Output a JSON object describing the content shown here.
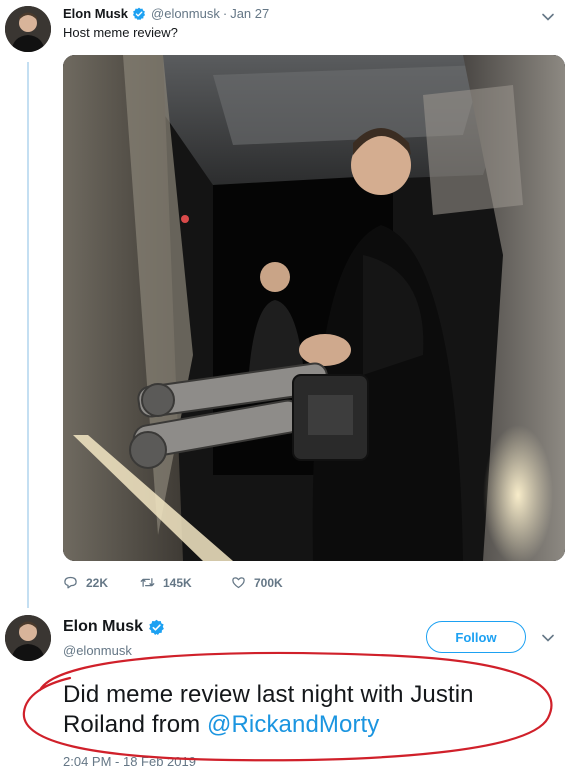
{
  "tweet1": {
    "author_name": "Elon Musk",
    "handle": "@elonmusk",
    "separator": "·",
    "date": "Jan 27",
    "text": "Host meme review?",
    "actions": {
      "replies": "22K",
      "retweets": "145K",
      "likes": "700K"
    }
  },
  "tweet2": {
    "author_name": "Elon Musk",
    "handle": "@elonmusk",
    "follow_label": "Follow",
    "text_before_mention": "Did meme review last night with Justin Roiland from ",
    "mention": "@RickandMorty",
    "timestamp": "2:04 PM - 18 Feb 2019"
  },
  "icons": {
    "verified": "verified-badge-icon",
    "chevron": "chevron-down-icon",
    "reply": "reply-icon",
    "retweet": "retweet-icon",
    "like": "heart-icon"
  },
  "colors": {
    "accent": "#1da1f2",
    "mention": "#1b95e0",
    "secondary_text": "#657786",
    "thread_line": "#c4dff2",
    "annotation_ellipse": "#d0202a"
  }
}
